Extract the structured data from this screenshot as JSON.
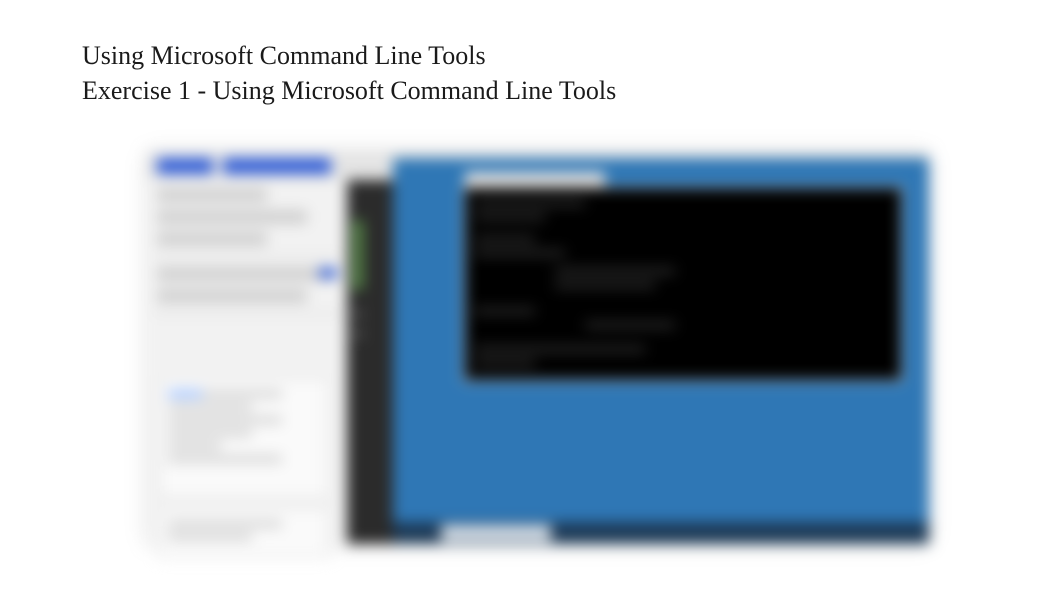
{
  "heading": {
    "line1": "Using Microsoft Command Line Tools",
    "line2": "Exercise 1 - Using Microsoft Command Line Tools"
  }
}
